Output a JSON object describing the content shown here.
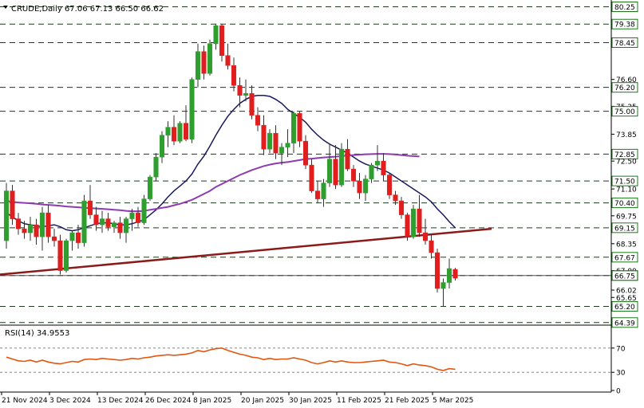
{
  "header": {
    "text": "CRUDE,Daily  67.06 67.13 66.50 66.62"
  },
  "rsi_header": {
    "text": "RSI(14) 34.9553"
  },
  "chart_data": {
    "type": "candlestick",
    "symbol": "CRUDE",
    "timeframe": "Daily",
    "ohlc_last": {
      "open": 67.06,
      "high": 67.13,
      "low": 66.5,
      "close": 66.62
    },
    "ylim": [
      64.3,
      80.35
    ],
    "x_ticks": [
      "21 Nov 2024",
      "3 Dec 2024",
      "13 Dec 2024",
      "26 Dec 2024",
      "8 Jan 2025",
      "20 Jan 2025",
      "30 Jan 2025",
      "11 Feb 2025",
      "21 Feb 2025",
      "5 Mar 2025"
    ],
    "x_tick_index": [
      0,
      8,
      16,
      24,
      32,
      40,
      48,
      56,
      64,
      72
    ],
    "price_ticks": [
      80.25,
      79.38,
      78.45,
      76.6,
      76.2,
      75.25,
      75.0,
      73.85,
      72.85,
      72.5,
      71.5,
      71.1,
      70.4,
      69.75,
      69.15,
      68.35,
      67.67,
      67.0,
      66.75,
      66.02,
      65.65,
      65.2,
      64.39
    ],
    "boxed_levels": [
      80.25,
      79.38,
      78.45,
      76.2,
      75.0,
      72.85,
      71.5,
      70.4,
      69.15,
      67.67,
      66.75,
      65.2,
      64.39
    ],
    "current_price": 66.75,
    "horizontal_levels": [
      80.25,
      79.38,
      78.45,
      76.2,
      75.0,
      72.85,
      71.5,
      70.4,
      69.15,
      67.67,
      66.75,
      65.2,
      64.39
    ],
    "trendline": {
      "start": [
        0,
        66.8
      ],
      "end": [
        80,
        69.1
      ],
      "color": "#8b1a1a"
    },
    "candles": [
      [
        68.5,
        71.4,
        68.1,
        71.0
      ],
      [
        71.0,
        71.3,
        69.3,
        69.6
      ],
      [
        69.6,
        69.9,
        68.8,
        69.1
      ],
      [
        69.1,
        69.5,
        68.6,
        68.9
      ],
      [
        68.9,
        69.7,
        68.5,
        69.3
      ],
      [
        69.3,
        69.6,
        68.3,
        68.7
      ],
      [
        68.7,
        70.2,
        68.0,
        69.9
      ],
      [
        69.9,
        70.3,
        68.4,
        68.7
      ],
      [
        68.7,
        69.1,
        68.2,
        68.5
      ],
      [
        68.5,
        68.8,
        66.8,
        67.0
      ],
      [
        67.0,
        68.6,
        66.9,
        68.5
      ],
      [
        68.5,
        69.0,
        68.0,
        68.9
      ],
      [
        68.9,
        69.3,
        68.1,
        68.4
      ],
      [
        68.4,
        70.8,
        68.2,
        70.5
      ],
      [
        70.5,
        71.3,
        69.6,
        69.8
      ],
      [
        69.8,
        70.2,
        69.0,
        69.3
      ],
      [
        69.3,
        70.0,
        68.9,
        69.6
      ],
      [
        69.6,
        69.9,
        69.0,
        69.2
      ],
      [
        69.2,
        69.5,
        68.9,
        69.4
      ],
      [
        69.4,
        69.7,
        68.6,
        68.9
      ],
      [
        68.9,
        69.7,
        68.4,
        69.6
      ],
      [
        69.6,
        70.1,
        69.0,
        69.9
      ],
      [
        69.9,
        70.2,
        69.2,
        69.4
      ],
      [
        69.4,
        70.8,
        69.3,
        70.6
      ],
      [
        70.6,
        71.8,
        70.5,
        71.7
      ],
      [
        71.7,
        72.9,
        71.5,
        72.7
      ],
      [
        72.7,
        74.0,
        72.4,
        73.8
      ],
      [
        73.8,
        74.5,
        73.2,
        74.2
      ],
      [
        74.2,
        74.8,
        73.3,
        73.5
      ],
      [
        73.5,
        74.5,
        73.4,
        74.4
      ],
      [
        74.4,
        75.3,
        73.5,
        73.6
      ],
      [
        73.6,
        76.7,
        73.4,
        76.6
      ],
      [
        76.6,
        78.4,
        76.2,
        78.0
      ],
      [
        78.0,
        78.3,
        76.6,
        76.9
      ],
      [
        76.9,
        78.6,
        76.8,
        78.4
      ],
      [
        78.4,
        79.4,
        78.1,
        79.3
      ],
      [
        79.3,
        79.4,
        77.5,
        77.8
      ],
      [
        77.8,
        78.4,
        77.1,
        77.3
      ],
      [
        77.3,
        77.7,
        76.0,
        76.3
      ],
      [
        76.3,
        76.7,
        75.2,
        75.8
      ],
      [
        75.8,
        76.6,
        75.5,
        75.9
      ],
      [
        75.9,
        76.3,
        74.6,
        74.8
      ],
      [
        74.8,
        75.2,
        74.0,
        74.3
      ],
      [
        74.3,
        74.8,
        72.8,
        73.1
      ],
      [
        73.1,
        74.1,
        72.9,
        73.9
      ],
      [
        73.9,
        74.3,
        72.6,
        72.9
      ],
      [
        72.9,
        73.4,
        72.3,
        73.2
      ],
      [
        73.2,
        74.1,
        72.7,
        73.4
      ],
      [
        73.4,
        75.0,
        72.9,
        74.9
      ],
      [
        74.9,
        75.0,
        73.2,
        73.5
      ],
      [
        73.5,
        73.8,
        72.1,
        72.3
      ],
      [
        72.3,
        72.6,
        70.9,
        71.0
      ],
      [
        71.0,
        71.5,
        70.4,
        70.6
      ],
      [
        70.6,
        71.6,
        70.2,
        71.4
      ],
      [
        71.4,
        73.4,
        71.2,
        72.6
      ],
      [
        72.6,
        73.3,
        71.1,
        71.3
      ],
      [
        71.3,
        73.4,
        71.2,
        73.1
      ],
      [
        73.1,
        73.6,
        72.0,
        72.1
      ],
      [
        72.1,
        72.3,
        71.2,
        71.5
      ],
      [
        71.5,
        71.9,
        70.6,
        70.9
      ],
      [
        70.9,
        71.8,
        70.5,
        71.6
      ],
      [
        71.6,
        72.4,
        71.4,
        72.3
      ],
      [
        72.3,
        73.3,
        72.0,
        72.5
      ],
      [
        72.5,
        72.9,
        71.5,
        71.8
      ],
      [
        71.8,
        71.9,
        70.6,
        70.8
      ],
      [
        70.8,
        71.0,
        70.3,
        70.5
      ],
      [
        70.5,
        70.7,
        69.6,
        69.8
      ],
      [
        69.8,
        69.9,
        68.5,
        68.7
      ],
      [
        68.7,
        70.3,
        68.6,
        70.1
      ],
      [
        70.1,
        70.8,
        68.7,
        68.9
      ],
      [
        68.9,
        69.6,
        68.3,
        68.5
      ],
      [
        68.5,
        68.8,
        67.6,
        67.9
      ],
      [
        67.9,
        68.1,
        65.9,
        66.1
      ],
      [
        66.1,
        66.6,
        65.2,
        66.4
      ],
      [
        66.4,
        67.6,
        66.1,
        67.1
      ],
      [
        67.06,
        67.13,
        66.5,
        66.62
      ]
    ],
    "series": [
      {
        "name": "",
        "color": "#1a1a5e",
        "values": [
          69.9,
          69.7,
          69.5,
          69.35,
          69.3,
          69.25,
          69.2,
          69.25,
          69.3,
          69.2,
          69.05,
          69.0,
          69.05,
          69.15,
          69.25,
          69.35,
          69.4,
          69.4,
          69.35,
          69.3,
          69.3,
          69.35,
          69.45,
          69.55,
          69.8,
          70.05,
          70.35,
          70.7,
          71.0,
          71.25,
          71.5,
          71.85,
          72.35,
          72.75,
          73.25,
          73.8,
          74.3,
          74.75,
          75.1,
          75.4,
          75.6,
          75.75,
          75.8,
          75.8,
          75.75,
          75.6,
          75.4,
          75.1,
          74.9,
          74.7,
          74.45,
          74.1,
          73.8,
          73.55,
          73.35,
          73.2,
          73.05,
          72.9,
          72.7,
          72.5,
          72.35,
          72.25,
          72.15,
          72.05,
          71.9,
          71.7,
          71.5,
          71.3,
          71.1,
          70.9,
          70.7,
          70.45,
          70.1,
          69.8,
          69.45,
          69.15
        ]
      },
      {
        "name": "",
        "color": "#8e3ab0",
        "values": [
          70.5,
          70.45,
          70.42,
          70.4,
          70.38,
          70.35,
          70.32,
          70.3,
          70.28,
          70.25,
          70.22,
          70.2,
          70.18,
          70.15,
          70.13,
          70.12,
          70.1,
          70.08,
          70.05,
          70.03,
          70.0,
          69.98,
          69.98,
          70.0,
          70.05,
          70.1,
          70.15,
          70.2,
          70.28,
          70.35,
          70.45,
          70.55,
          70.7,
          70.85,
          71.0,
          71.2,
          71.35,
          71.5,
          71.65,
          71.8,
          71.92,
          72.05,
          72.15,
          72.25,
          72.32,
          72.38,
          72.42,
          72.45,
          72.5,
          72.55,
          72.6,
          72.62,
          72.65,
          72.68,
          72.7,
          72.72,
          72.75,
          72.78,
          72.8,
          72.82,
          72.84,
          72.85,
          72.86,
          72.86,
          72.85,
          72.83,
          72.8,
          72.77,
          72.75,
          72.73
        ]
      }
    ],
    "rsi": {
      "label": "RSI(14)",
      "value": 34.9553,
      "ylim": [
        0,
        100
      ],
      "ticks": [
        70,
        30,
        0
      ],
      "color": "#e2560e",
      "values": [
        55,
        52,
        49,
        48,
        50,
        47,
        50,
        47,
        45,
        44,
        46,
        48,
        47,
        51,
        52,
        51,
        53,
        52,
        51,
        50,
        51,
        53,
        52,
        54,
        55,
        57,
        58,
        59,
        58,
        59,
        60,
        62,
        66,
        64,
        67,
        69,
        70,
        66,
        63,
        60,
        58,
        55,
        54,
        51,
        53,
        51,
        52,
        52,
        54,
        52,
        50,
        46,
        44,
        46,
        49,
        47,
        49,
        47,
        46,
        46,
        47,
        48,
        49,
        50,
        47,
        46,
        44,
        41,
        44,
        42,
        41,
        39,
        35,
        33,
        36,
        35
      ]
    }
  }
}
